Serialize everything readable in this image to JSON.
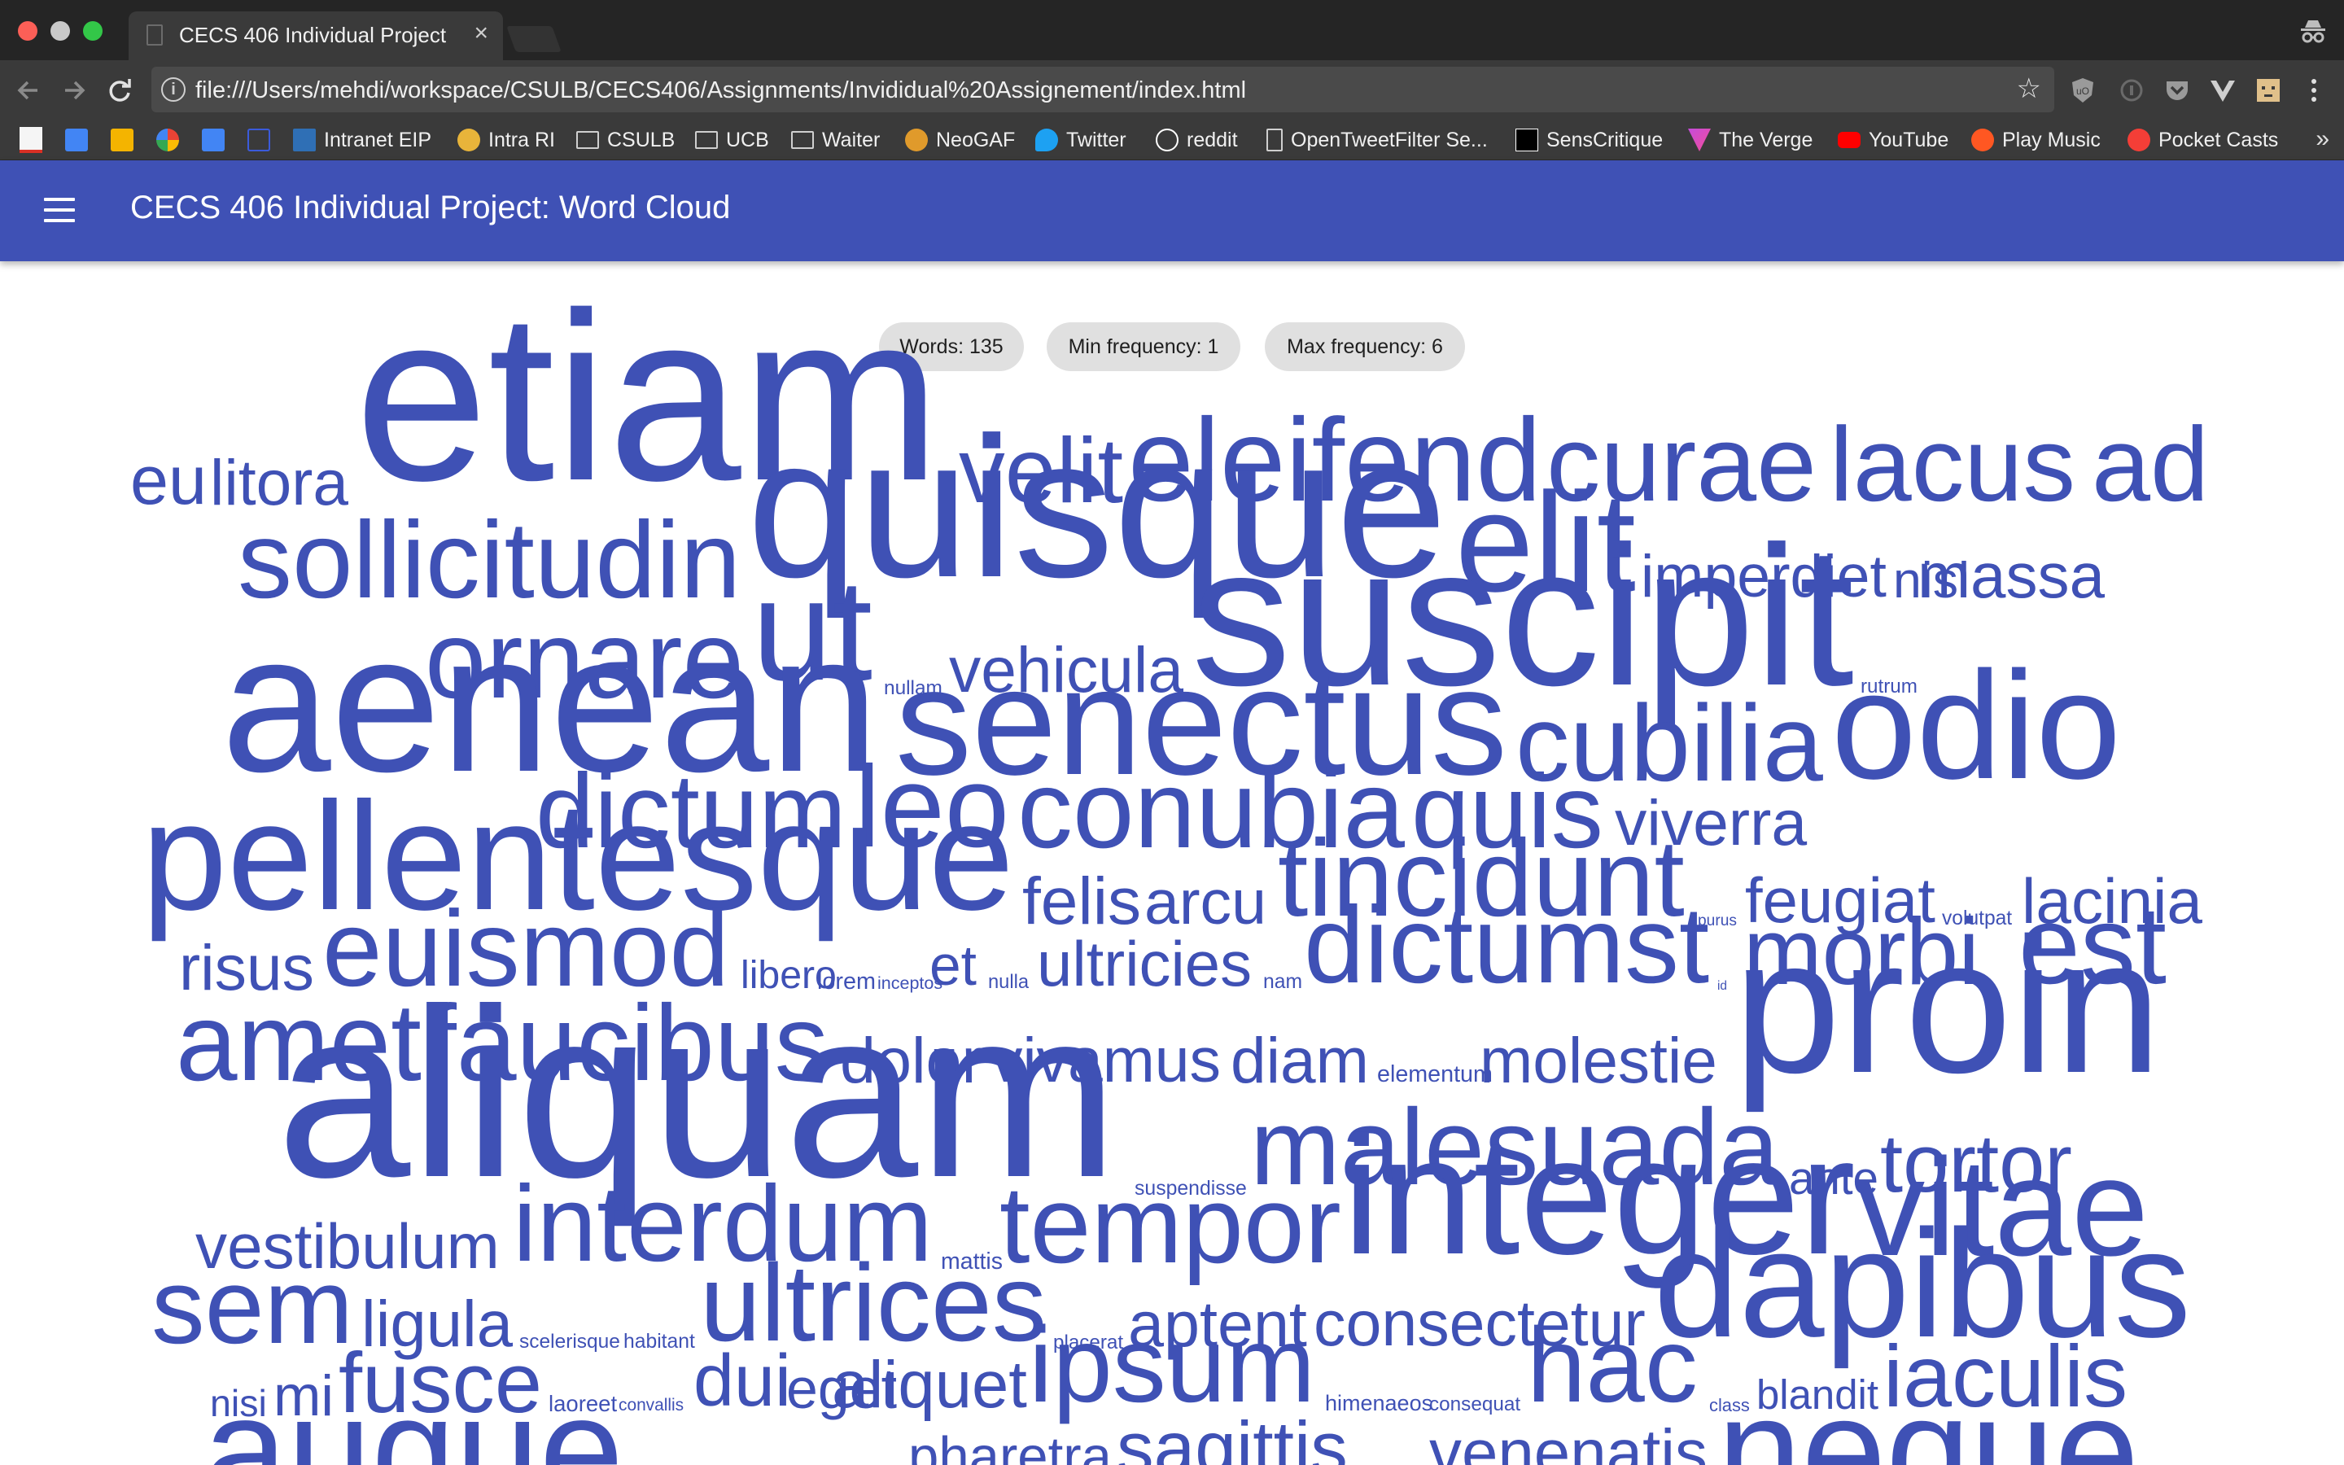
{
  "browser": {
    "tab_title": "CECS 406 Individual Project",
    "tab_close": "×",
    "url": "file:///Users/mehdi/workspace/CSULB/CECS406/Assignments/Invididual%20Assignement/index.html",
    "info_glyph": "i",
    "star_glyph": "☆",
    "bookmarks": [
      {
        "label": "",
        "icon": "gmail-icon",
        "color": "#d93025"
      },
      {
        "label": "",
        "icon": "calendar-icon",
        "color": "#4285f4"
      },
      {
        "label": "",
        "icon": "keep-icon",
        "color": "#f4b400"
      },
      {
        "label": "",
        "icon": "photos-icon",
        "color": "#ea4335"
      },
      {
        "label": "",
        "icon": "inbox-icon",
        "color": "#4285f4"
      },
      {
        "label": "",
        "icon": "brackets-icon",
        "color": "#3b5bdb"
      },
      {
        "label": "Intranet EIP",
        "icon": "eip-icon",
        "color": "#2f6fb5"
      },
      {
        "label": "Intra RI",
        "icon": "globe-icon",
        "color": "#e8b43a"
      },
      {
        "label": "CSULB",
        "icon": "folder-icon",
        "color": "#cfcfcf"
      },
      {
        "label": "UCB",
        "icon": "folder-icon",
        "color": "#cfcfcf"
      },
      {
        "label": "Waiter",
        "icon": "folder-icon",
        "color": "#cfcfcf"
      },
      {
        "label": "NeoGAF",
        "icon": "neogaf-icon",
        "color": "#e09a2b"
      },
      {
        "label": "Twitter",
        "icon": "twitter-icon",
        "color": "#1da1f2"
      },
      {
        "label": "reddit",
        "icon": "reddit-icon",
        "color": "#ffffff"
      },
      {
        "label": "OpenTweetFilter Se...",
        "icon": "page-icon",
        "color": "#cfcfcf"
      },
      {
        "label": "SensCritique",
        "icon": "senscritique-icon",
        "color": "#ffffff"
      },
      {
        "label": "The Verge",
        "icon": "verge-icon",
        "color": "#c54bdb"
      },
      {
        "label": "YouTube",
        "icon": "youtube-icon",
        "color": "#ff0000"
      },
      {
        "label": "Play Music",
        "icon": "playmusic-icon",
        "color": "#ff5722"
      },
      {
        "label": "Pocket Casts",
        "icon": "pocketcasts-icon",
        "color": "#f43e37"
      }
    ],
    "bookmarks_more": "»"
  },
  "app": {
    "title": "CECS 406 Individual Project: Word Cloud",
    "accent": "#3f51b5"
  },
  "stats": {
    "words": "Words: 135",
    "min_frequency": "Min frequency: 1",
    "max_frequency": "Max frequency: 6"
  },
  "cloud": {
    "color": "#3f51b5",
    "words": [
      {
        "text": "etiam",
        "size": 6
      },
      {
        "text": "eu",
        "size": 2
      },
      {
        "text": "litora",
        "size": 2
      },
      {
        "text": "velit",
        "size": 3
      },
      {
        "text": "eleifend",
        "size": 3
      },
      {
        "text": "curae",
        "size": 3
      },
      {
        "text": "lacus",
        "size": 3
      },
      {
        "text": "ad",
        "size": 3
      },
      {
        "text": "quisque",
        "size": 5
      },
      {
        "text": "sollicitudin",
        "size": 3
      },
      {
        "text": "elit",
        "size": 2
      },
      {
        "text": "imperdiet",
        "size": 2
      },
      {
        "text": "nisl",
        "size": 2
      },
      {
        "text": "massa",
        "size": 2
      },
      {
        "text": "suscipit",
        "size": 5
      },
      {
        "text": "ornare",
        "size": 3
      },
      {
        "text": "ut",
        "size": 4
      },
      {
        "text": "nullam",
        "size": 1
      },
      {
        "text": "vehicula",
        "size": 2
      },
      {
        "text": "rutrum",
        "size": 1
      },
      {
        "text": "aenean",
        "size": 5
      },
      {
        "text": "senectus",
        "size": 4
      },
      {
        "text": "cubilia",
        "size": 3
      },
      {
        "text": "odio",
        "size": 4
      },
      {
        "text": "dictum",
        "size": 3
      },
      {
        "text": "leo",
        "size": 3
      },
      {
        "text": "conubia",
        "size": 3
      },
      {
        "text": "quis",
        "size": 3
      },
      {
        "text": "viverra",
        "size": 2
      },
      {
        "text": "pellentesque",
        "size": 4
      },
      {
        "text": "felis",
        "size": 2
      },
      {
        "text": "arcu",
        "size": 2
      },
      {
        "text": "tincidunt",
        "size": 3
      },
      {
        "text": "purus",
        "size": 1
      },
      {
        "text": "feugiat",
        "size": 2
      },
      {
        "text": "volutpat",
        "size": 1
      },
      {
        "text": "lacinia",
        "size": 2
      },
      {
        "text": "risus",
        "size": 2
      },
      {
        "text": "euismod",
        "size": 3
      },
      {
        "text": "libero",
        "size": 1
      },
      {
        "text": "lorem",
        "size": 1
      },
      {
        "text": "inceptos",
        "size": 1
      },
      {
        "text": "et",
        "size": 2
      },
      {
        "text": "nulla",
        "size": 1
      },
      {
        "text": "ultricies",
        "size": 2
      },
      {
        "text": "nam",
        "size": 1
      },
      {
        "text": "dictumst",
        "size": 3
      },
      {
        "text": "id",
        "size": 1
      },
      {
        "text": "morbi",
        "size": 3
      },
      {
        "text": "est",
        "size": 3
      },
      {
        "text": "amet",
        "size": 3
      },
      {
        "text": "faucibus",
        "size": 3
      },
      {
        "text": "proin",
        "size": 5
      },
      {
        "text": "dolor",
        "size": 2
      },
      {
        "text": "vivamus",
        "size": 2
      },
      {
        "text": "diam",
        "size": 2
      },
      {
        "text": "elementum",
        "size": 1
      },
      {
        "text": "molestie",
        "size": 2
      },
      {
        "text": "aliquam",
        "size": 6
      },
      {
        "text": "malesuada",
        "size": 3
      },
      {
        "text": "ante",
        "size": 2
      },
      {
        "text": "tortor",
        "size": 2
      },
      {
        "text": "suspendisse",
        "size": 1
      },
      {
        "text": "vestibulum",
        "size": 2
      },
      {
        "text": "interdum",
        "size": 3
      },
      {
        "text": "mattis",
        "size": 1
      },
      {
        "text": "tempor",
        "size": 3
      },
      {
        "text": "integer",
        "size": 4
      },
      {
        "text": "vitae",
        "size": 4
      },
      {
        "text": "sem",
        "size": 3
      },
      {
        "text": "ligula",
        "size": 2
      },
      {
        "text": "scelerisque",
        "size": 1
      },
      {
        "text": "habitant",
        "size": 1
      },
      {
        "text": "ultrices",
        "size": 3
      },
      {
        "text": "placerat",
        "size": 1
      },
      {
        "text": "aptent",
        "size": 2
      },
      {
        "text": "consectetur",
        "size": 2
      },
      {
        "text": "dapibus",
        "size": 4
      },
      {
        "text": "nisi",
        "size": 2
      },
      {
        "text": "mi",
        "size": 2
      },
      {
        "text": "fusce",
        "size": 2
      },
      {
        "text": "laoreet",
        "size": 1
      },
      {
        "text": "convallis",
        "size": 1
      },
      {
        "text": "dui",
        "size": 2
      },
      {
        "text": "eget",
        "size": 1
      },
      {
        "text": "aliquet",
        "size": 2
      },
      {
        "text": "ipsum",
        "size": 3
      },
      {
        "text": "himenaeos",
        "size": 1
      },
      {
        "text": "consequat",
        "size": 1
      },
      {
        "text": "hac",
        "size": 3
      },
      {
        "text": "class",
        "size": 1
      },
      {
        "text": "blandit",
        "size": 2
      },
      {
        "text": "iaculis",
        "size": 2
      },
      {
        "text": "augue",
        "size": 4
      },
      {
        "text": "pharetra",
        "size": 2
      },
      {
        "text": "sagittis",
        "size": 2
      },
      {
        "text": "venenatis",
        "size": 2
      },
      {
        "text": "neque",
        "size": 4
      }
    ]
  }
}
